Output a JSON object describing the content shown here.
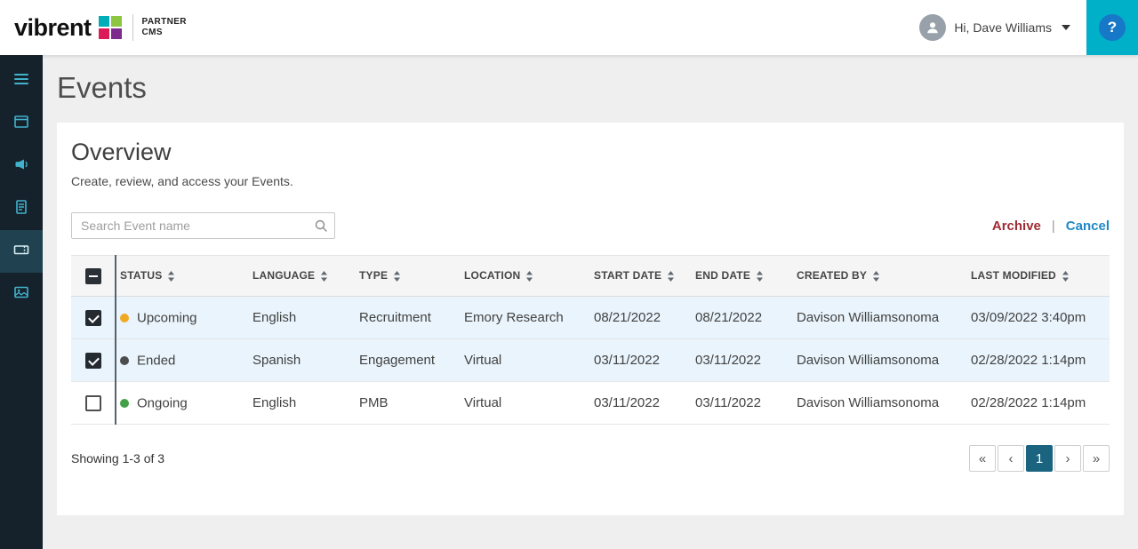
{
  "header": {
    "logo_text": "vibrent",
    "product_line1": "PARTNER",
    "product_line2": "CMS",
    "greeting": "Hi, Dave Williams",
    "help_label": "?"
  },
  "sidebar": {
    "items": [
      {
        "icon": "menu-icon"
      },
      {
        "icon": "window-icon"
      },
      {
        "icon": "megaphone-icon"
      },
      {
        "icon": "document-icon"
      },
      {
        "icon": "event-ticket-icon",
        "selected": true
      },
      {
        "icon": "media-icon"
      }
    ]
  },
  "page": {
    "title": "Events"
  },
  "overview": {
    "title": "Overview",
    "subtitle": "Create, review, and access your Events.",
    "search_placeholder": "Search Event name",
    "archive_label": "Archive",
    "separator": "|",
    "cancel_label": "Cancel"
  },
  "table": {
    "select_all_state": "indeterminate",
    "columns": [
      "STATUS",
      "LANGUAGE",
      "TYPE",
      "LOCATION",
      "START DATE",
      "END DATE",
      "CREATED BY",
      "LAST MODIFIED"
    ],
    "rows": [
      {
        "checked": true,
        "status": "Upcoming",
        "status_color": "#F0A922",
        "language": "English",
        "type": "Recruitment",
        "location": "Emory Research",
        "start_date": "08/21/2022",
        "end_date": "08/21/2022",
        "created_by": "Davison Williamsonoma",
        "last_modified": "03/09/2022 3:40pm"
      },
      {
        "checked": true,
        "status": "Ended",
        "status_color": "#4D4D4D",
        "language": "Spanish",
        "type": "Engagement",
        "location": "Virtual",
        "start_date": "03/11/2022",
        "end_date": "03/11/2022",
        "created_by": "Davison Williamsonoma",
        "last_modified": "02/28/2022 1:14pm"
      },
      {
        "checked": false,
        "status": "Ongoing",
        "status_color": "#43A047",
        "language": "English",
        "type": "PMB",
        "location": "Virtual",
        "start_date": "03/11/2022",
        "end_date": "03/11/2022",
        "created_by": "Davison Williamsonoma",
        "last_modified": "02/28/2022 1:14pm"
      }
    ]
  },
  "footer": {
    "showing": "Showing 1-3 of 3",
    "pagination": {
      "first": "«",
      "prev": "‹",
      "current": "1",
      "next": "›",
      "last": "»",
      "active_page": "1"
    }
  },
  "colors": {
    "logo": [
      "#00AEB8",
      "#8DC63F",
      "#DC1A59",
      "#7E2B8E"
    ],
    "accent_teal": "#00AFC8",
    "sidebar_bg": "#15222C",
    "archive_link": "#9E2B33",
    "cancel_link": "#1E88C7",
    "selected_row_bg": "#E9F4FC",
    "pagination_active": "#1A6480"
  }
}
